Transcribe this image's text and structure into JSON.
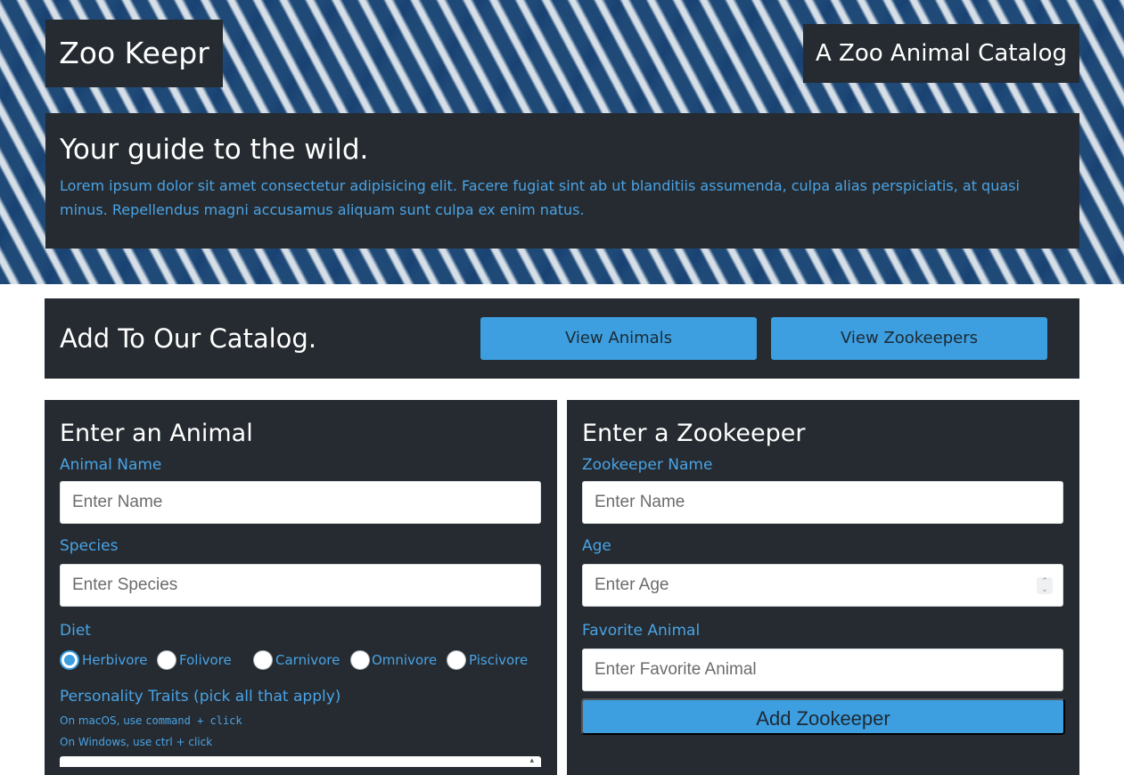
{
  "header": {
    "logo": "Zoo Keepr",
    "tagline": "A Zoo Animal Catalog",
    "hero_title": "Your guide to the wild.",
    "hero_text": "Lorem ipsum dolor sit amet consectetur adipisicing elit. Facere fugiat sint ab ut blanditiis assumenda, culpa alias perspiciatis, at quasi minus. Repellendus magni accusamus aliquam sunt culpa ex enim natus."
  },
  "catalog": {
    "title": "Add To Our Catalog.",
    "view_animals": "View Animals",
    "view_zookeepers": "View Zookeepers"
  },
  "animal_form": {
    "title": "Enter an Animal",
    "name_label": "Animal Name",
    "name_placeholder": "Enter Name",
    "species_label": "Species",
    "species_placeholder": "Enter Species",
    "diet_label": "Diet",
    "diet_options": [
      "Herbivore",
      "Folivore",
      "Carnivore",
      "Omnivore",
      "Piscivore"
    ],
    "diet_selected": "Herbivore",
    "traits_label": "Personality Traits (pick all that apply)",
    "hint_mac_prefix": "On macOS, use",
    "hint_mac_code": "command + click",
    "hint_windows": "On Windows, use ctrl + click"
  },
  "keeper_form": {
    "title": "Enter a Zookeeper",
    "name_label": "Zookeeper Name",
    "name_placeholder": "Enter Name",
    "age_label": "Age",
    "age_placeholder": "Enter Age",
    "favorite_label": "Favorite Animal",
    "favorite_placeholder": "Enter Favorite Animal",
    "submit_label": "Add Zookeeper"
  },
  "colors": {
    "accent": "#3d9ee0",
    "panel": "#252b30",
    "label": "#4aa3e6"
  }
}
